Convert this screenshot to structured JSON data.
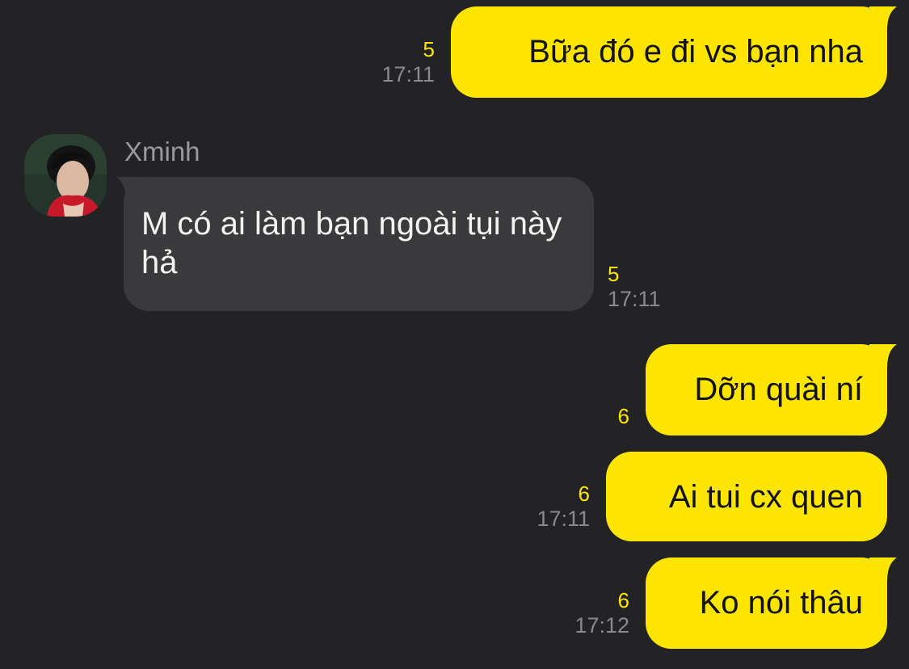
{
  "messages": [
    {
      "text": "Bữa đó e đi vs bạn nha",
      "unread": "5",
      "time": "17:11"
    },
    {
      "sender": "Xminh",
      "text": "M có ai làm bạn ngoài tụi này hả",
      "unread": "5",
      "time": "17:11"
    },
    {
      "text": "Dỡn quài ní",
      "unread": "6",
      "time": ""
    },
    {
      "text": "Ai tui cx quen",
      "unread": "6",
      "time": "17:11"
    },
    {
      "text": "Ko nói thâu",
      "unread": "6",
      "time": "17:12"
    }
  ],
  "theme": {
    "background": "#232325",
    "outgoing_bubble": "#fee500",
    "incoming_bubble": "#3a3a3c",
    "unread_color": "#fee500",
    "time_color": "#8a8a8e"
  },
  "icons": {
    "avatar": "profile-photo"
  }
}
